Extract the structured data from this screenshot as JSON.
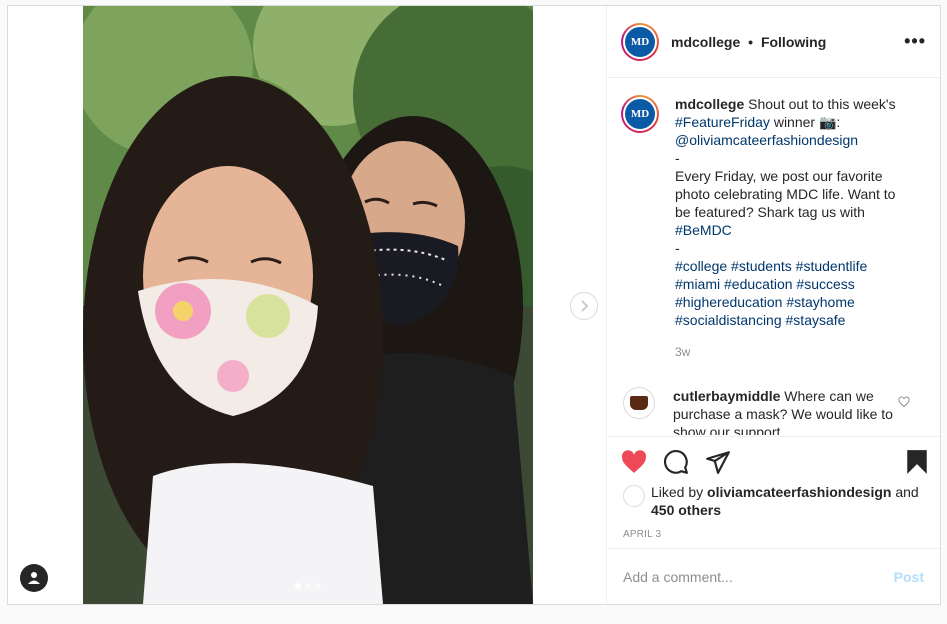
{
  "post": {
    "account": {
      "username": "mdcollege",
      "separator": "•",
      "follow_status": "Following",
      "avatar_letters": "MD"
    },
    "caption": {
      "username": "mdcollege",
      "lines": [
        {
          "text": "Shout out to this week's "
        },
        {
          "link": "#FeatureFriday"
        },
        {
          "text": " winner 📷:"
        },
        {
          "br": true
        },
        {
          "link": "@oliviamcateerfashiondesign"
        },
        {
          "br": true
        },
        {
          "text": "-"
        },
        {
          "br": true
        },
        {
          "text": "Every Friday, we post our favorite photo celebrating MDC life. Want to be featured? Shark tag us with "
        },
        {
          "link": "#BeMDC"
        },
        {
          "br": true
        },
        {
          "text": "-"
        },
        {
          "br": true
        },
        {
          "link": "#college"
        },
        {
          "text": " "
        },
        {
          "link": "#students"
        },
        {
          "text": " "
        },
        {
          "link": "#studentlife"
        },
        {
          "text": " "
        },
        {
          "link": "#miami"
        },
        {
          "text": " "
        },
        {
          "link": "#education"
        },
        {
          "text": " "
        },
        {
          "link": "#success"
        },
        {
          "text": " "
        },
        {
          "link": "#highereducation"
        },
        {
          "text": " "
        },
        {
          "link": "#stayhome"
        },
        {
          "text": " "
        },
        {
          "link": "#socialdistancing"
        },
        {
          "text": " "
        },
        {
          "link": "#staysafe"
        }
      ],
      "time": "3w"
    },
    "comment": {
      "username": "cutlerbaymiddle",
      "text": "Where can we purchase a mask? We would like to show our support"
    },
    "likes": {
      "prefix": "Liked by",
      "liker": "oliviamcateerfashiondesign",
      "and": "and",
      "others": "450 others"
    },
    "date": "APRIL 3",
    "comment_input": {
      "placeholder": "Add a comment...",
      "value": ""
    },
    "post_button": "Post",
    "carousel": {
      "total": 3,
      "active_index": 0
    }
  },
  "colors": {
    "heart": "#ed4956",
    "link": "#00376b",
    "post_button": "#b2dffc",
    "secondary_text": "#8e8e8e"
  },
  "icons": [
    "more-icon",
    "heart-icon",
    "comment-icon",
    "share-icon",
    "bookmark-icon",
    "chevron-right-icon",
    "user-tag-icon",
    "heart-outline-icon"
  ]
}
